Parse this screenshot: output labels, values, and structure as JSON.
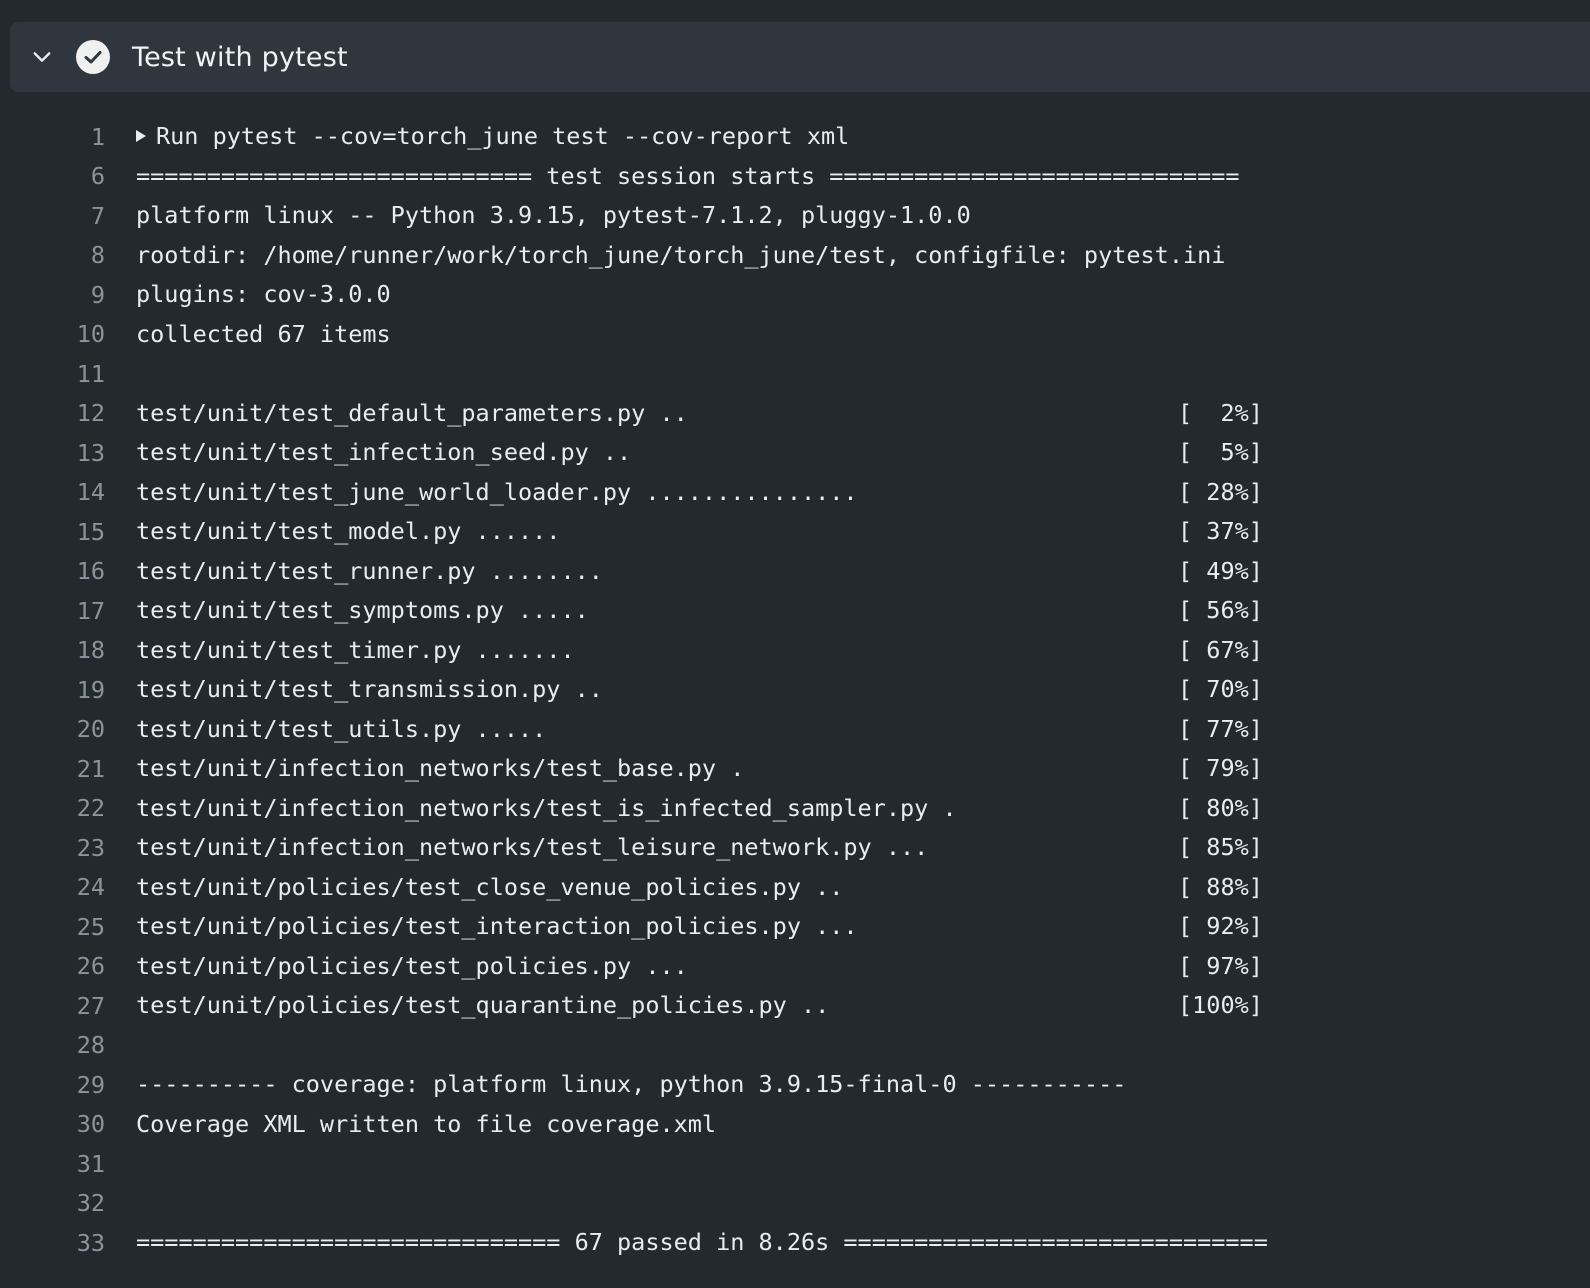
{
  "step": {
    "title": "Test with pytest",
    "status": "success",
    "chevron_icon": "chevron-down-icon",
    "status_icon": "check-circle-icon"
  },
  "log": {
    "lines": [
      {
        "n": "1",
        "text": "Run pytest --cov=torch_june test --cov-report xml",
        "pct": "",
        "collapsible": true
      },
      {
        "n": "6",
        "text": "============================ test session starts =============================",
        "pct": ""
      },
      {
        "n": "7",
        "text": "platform linux -- Python 3.9.15, pytest-7.1.2, pluggy-1.0.0",
        "pct": ""
      },
      {
        "n": "8",
        "text": "rootdir: /home/runner/work/torch_june/torch_june/test, configfile: pytest.ini",
        "pct": ""
      },
      {
        "n": "9",
        "text": "plugins: cov-3.0.0",
        "pct": ""
      },
      {
        "n": "10",
        "text": "collected 67 items",
        "pct": ""
      },
      {
        "n": "11",
        "text": "",
        "pct": ""
      },
      {
        "n": "12",
        "text": "test/unit/test_default_parameters.py ..",
        "pct": "[  2%]"
      },
      {
        "n": "13",
        "text": "test/unit/test_infection_seed.py ..",
        "pct": "[  5%]"
      },
      {
        "n": "14",
        "text": "test/unit/test_june_world_loader.py ...............",
        "pct": "[ 28%]"
      },
      {
        "n": "15",
        "text": "test/unit/test_model.py ......",
        "pct": "[ 37%]"
      },
      {
        "n": "16",
        "text": "test/unit/test_runner.py ........",
        "pct": "[ 49%]"
      },
      {
        "n": "17",
        "text": "test/unit/test_symptoms.py .....",
        "pct": "[ 56%]"
      },
      {
        "n": "18",
        "text": "test/unit/test_timer.py .......",
        "pct": "[ 67%]"
      },
      {
        "n": "19",
        "text": "test/unit/test_transmission.py ..",
        "pct": "[ 70%]"
      },
      {
        "n": "20",
        "text": "test/unit/test_utils.py .....",
        "pct": "[ 77%]"
      },
      {
        "n": "21",
        "text": "test/unit/infection_networks/test_base.py .",
        "pct": "[ 79%]"
      },
      {
        "n": "22",
        "text": "test/unit/infection_networks/test_is_infected_sampler.py .",
        "pct": "[ 80%]"
      },
      {
        "n": "23",
        "text": "test/unit/infection_networks/test_leisure_network.py ...",
        "pct": "[ 85%]"
      },
      {
        "n": "24",
        "text": "test/unit/policies/test_close_venue_policies.py ..",
        "pct": "[ 88%]"
      },
      {
        "n": "25",
        "text": "test/unit/policies/test_interaction_policies.py ...",
        "pct": "[ 92%]"
      },
      {
        "n": "26",
        "text": "test/unit/policies/test_policies.py ...",
        "pct": "[ 97%]"
      },
      {
        "n": "27",
        "text": "test/unit/policies/test_quarantine_policies.py ..",
        "pct": "[100%]"
      },
      {
        "n": "28",
        "text": "",
        "pct": ""
      },
      {
        "n": "29",
        "text": "---------- coverage: platform linux, python 3.9.15-final-0 -----------",
        "pct": ""
      },
      {
        "n": "30",
        "text": "Coverage XML written to file coverage.xml",
        "pct": ""
      },
      {
        "n": "31",
        "text": "",
        "pct": ""
      },
      {
        "n": "32",
        "text": "",
        "pct": ""
      },
      {
        "n": "33",
        "text": "============================== 67 passed in 8.26s ==============================",
        "pct": ""
      }
    ]
  },
  "colors": {
    "background": "#24292e",
    "header_bg": "#30363d",
    "line_number": "#8b949e",
    "text": "#e6edf3"
  }
}
